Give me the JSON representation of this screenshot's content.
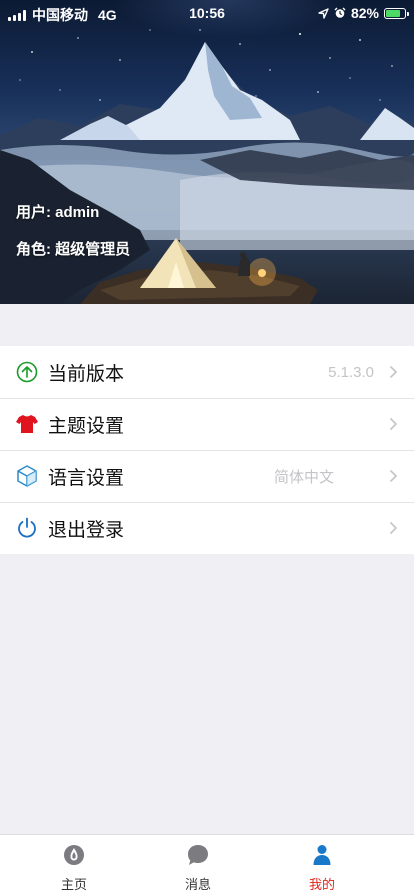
{
  "status_bar": {
    "carrier": "中国移动",
    "network": "4G",
    "time": "10:56",
    "battery_percent": "82%",
    "battery_level": 0.82
  },
  "profile": {
    "user_line": "用户: admin",
    "role_line": "角色: 超级管理员"
  },
  "menu": {
    "items": [
      {
        "label": "当前版本",
        "value": "5.1.3.0",
        "icon": "arrow-up-circle-icon",
        "color": "#1a9a2a"
      },
      {
        "label": "主题设置",
        "value": "",
        "icon": "tshirt-icon",
        "color": "#e0141e"
      },
      {
        "label": "语言设置",
        "value": "简体中文",
        "icon": "cube-icon",
        "color": "#2a8ccc"
      },
      {
        "label": "退出登录",
        "value": "",
        "icon": "power-icon",
        "color": "#1a6fc0"
      }
    ]
  },
  "tabbar": {
    "tabs": [
      {
        "label": "主页",
        "icon": "home-drop-icon",
        "active": false
      },
      {
        "label": "消息",
        "icon": "chat-bubble-icon",
        "active": false
      },
      {
        "label": "我的",
        "icon": "person-icon",
        "active": true
      }
    ],
    "active_color": "#e0281e"
  }
}
